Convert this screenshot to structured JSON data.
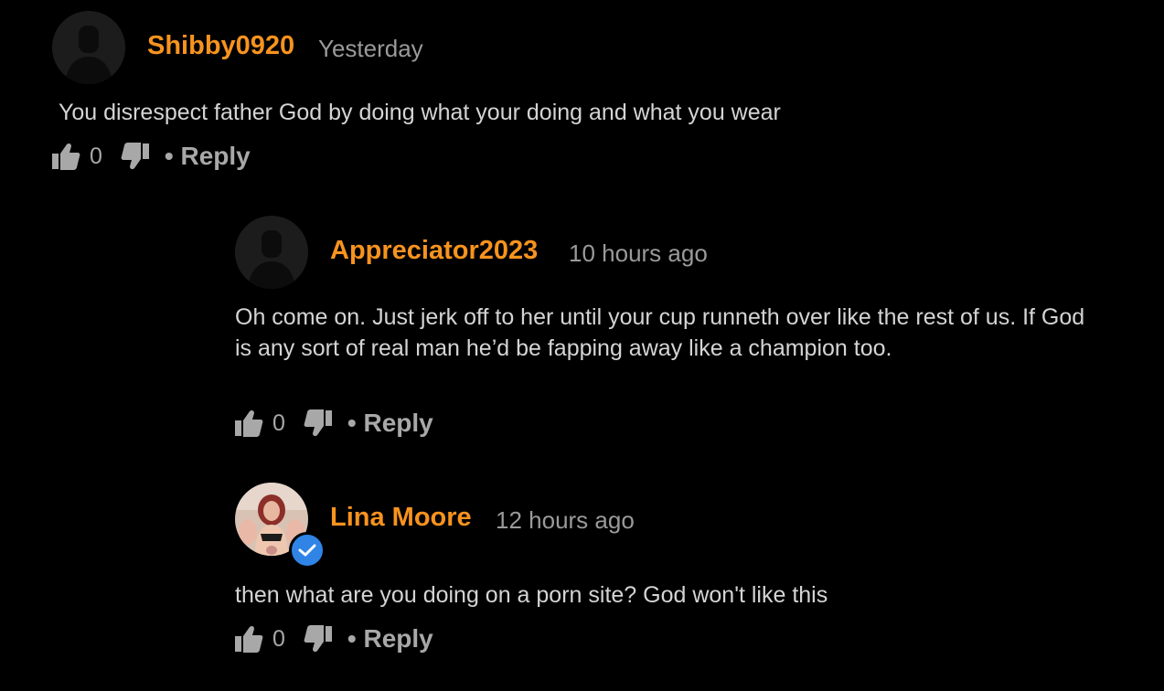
{
  "comments": [
    {
      "author": "Shibby0920",
      "time": "Yesterday",
      "text": "You disrespect father God by doing what your doing and what you wear",
      "likes": "0",
      "reply_label": "• Reply",
      "avatar_icon": "default-user-avatar"
    },
    {
      "author": "Appreciator2023",
      "time": "10 hours ago",
      "text": " Oh come on. Just jerk off to her until your cup runneth over like the rest of us. If God is any sort of real man he’d be fapping away like a champion too.",
      "likes": "0",
      "reply_label": "• Reply",
      "avatar_icon": "default-user-avatar"
    },
    {
      "author": "Lina Moore",
      "time": "12 hours ago",
      "text": " then what are you doing on a porn site? God won't like this",
      "likes": "0",
      "reply_label": "• Reply",
      "avatar_icon": "profile-photo",
      "verified": true
    }
  ],
  "colors": {
    "background": "#000000",
    "author": "#f7931e",
    "verified_badge": "#2f84e6"
  }
}
